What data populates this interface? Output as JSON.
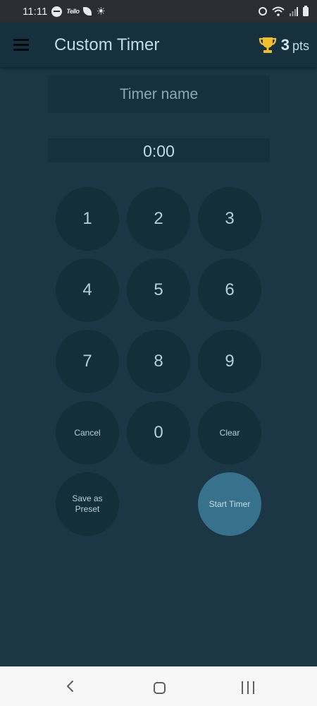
{
  "status_bar": {
    "time": "11:11",
    "carrier_badge": "Tello",
    "icons": [
      "do-not-disturb-icon",
      "tello-icon",
      "leaf-icon",
      "brightness-icon",
      "alarm-icon",
      "wifi-icon",
      "signal-icon",
      "battery-icon"
    ]
  },
  "app_bar": {
    "title": "Custom Timer",
    "points_value": "3",
    "points_unit": "pts",
    "trophy_color": "#f0c02c"
  },
  "timer_name": {
    "value": "",
    "placeholder": "Timer name"
  },
  "time_display": "0:00",
  "keypad": {
    "one": "1",
    "two": "2",
    "three": "3",
    "four": "4",
    "five": "5",
    "six": "6",
    "seven": "7",
    "eight": "8",
    "nine": "9",
    "cancel": "Cancel",
    "zero": "0",
    "clear": "Clear",
    "save_preset": "Save as Preset",
    "start_timer": "Start Timer"
  },
  "nav_bar": {
    "icons": [
      "back-icon",
      "home-icon",
      "recents-icon"
    ]
  },
  "colors": {
    "background": "#1b3745",
    "app_bar": "#16303d",
    "key": "#142e3a",
    "start_key": "#38718c"
  }
}
